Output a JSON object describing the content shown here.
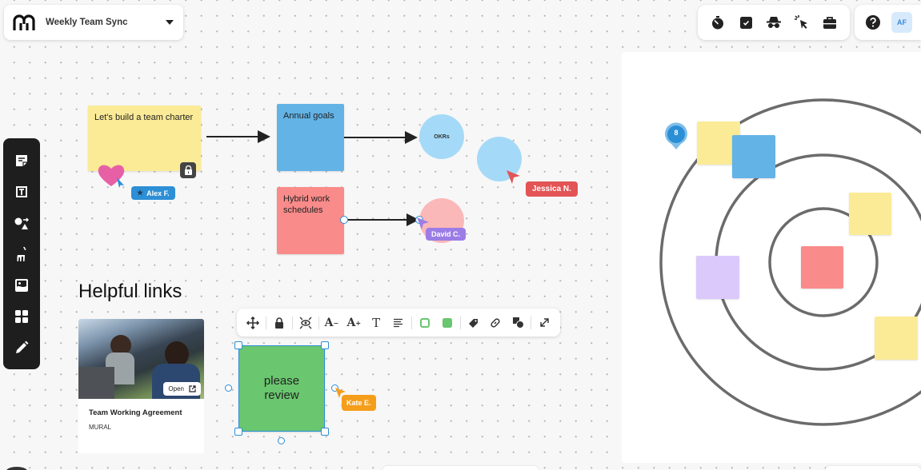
{
  "header": {
    "board_title": "Weekly Team Sync",
    "logo_icon": "mural-logo-icon",
    "dropdown_icon": "caret-down-icon"
  },
  "top_right_tools": [
    {
      "name": "timer",
      "icon": "stopwatch-icon"
    },
    {
      "name": "voting",
      "icon": "checkbox-icon"
    },
    {
      "name": "private-mode",
      "icon": "incognito-icon"
    },
    {
      "name": "summon",
      "icon": "cursor-click-icon"
    },
    {
      "name": "toolkit",
      "icon": "briefcase-icon"
    }
  ],
  "help": {
    "icon": "help-icon"
  },
  "user": {
    "initials": "AF"
  },
  "left_toolbar": [
    {
      "name": "sticky-note",
      "icon": "sticky-note-icon"
    },
    {
      "name": "text",
      "icon": "text-box-icon"
    },
    {
      "name": "shapes",
      "icon": "shapes-icon"
    },
    {
      "name": "templates",
      "icon": "llama-icon"
    },
    {
      "name": "images",
      "icon": "image-icon"
    },
    {
      "name": "frameworks",
      "icon": "grid-icon"
    },
    {
      "name": "draw",
      "icon": "pencil-icon"
    }
  ],
  "canvas": {
    "stickies": [
      {
        "id": "team-charter",
        "text": "Let's build a team charter",
        "color": "#fbeb96",
        "locked": true
      },
      {
        "id": "annual-goals",
        "text": "Annual goals",
        "color": "#63b3e6"
      },
      {
        "id": "hybrid-work",
        "text": "Hybrid work schedules",
        "color": "#f98b8a"
      },
      {
        "id": "please-review",
        "text": "please review",
        "color": "#6ac66f",
        "selected": true
      }
    ],
    "circles": [
      {
        "id": "okrs",
        "text": "OKRs",
        "color": "#a4daf7"
      },
      {
        "id": "blank-blue",
        "text": "",
        "color": "#a4daf7"
      },
      {
        "id": "blank-pink",
        "text": "",
        "color": "#fbb8b8"
      }
    ],
    "cursors": [
      {
        "name": "Alex F.",
        "color": "#2d8fd5",
        "starred": true
      },
      {
        "name": "Jessica N.",
        "color": "#e25455"
      },
      {
        "name": "David C.",
        "color": "#9c7ce6"
      },
      {
        "name": "Kate E.",
        "color": "#f59e1b"
      }
    ],
    "helpful_links": {
      "heading": "Helpful links",
      "card": {
        "title": "Team Working Agreement",
        "source": "MURAL",
        "open_label": "Open"
      }
    }
  },
  "context_toolbar": [
    {
      "name": "move",
      "icon": "move-icon"
    },
    {
      "name": "lock",
      "icon": "lock-icon"
    },
    {
      "name": "focus",
      "icon": "focus-eye-icon"
    },
    {
      "name": "decrease-font",
      "icon": "font-decrease-icon"
    },
    {
      "name": "increase-font",
      "icon": "font-increase-icon"
    },
    {
      "name": "text-style",
      "icon": "text-icon"
    },
    {
      "name": "align",
      "icon": "align-left-icon"
    },
    {
      "name": "border-color",
      "icon": "border-color-icon"
    },
    {
      "name": "fill-color",
      "icon": "fill-color-icon"
    },
    {
      "name": "tag",
      "icon": "tag-icon"
    },
    {
      "name": "link",
      "icon": "link-icon"
    },
    {
      "name": "shape",
      "icon": "shape-icon"
    },
    {
      "name": "expand",
      "icon": "expand-icon"
    }
  ],
  "target_panel": {
    "comment_count": "8",
    "rings": 3,
    "notes": [
      {
        "color": "#fbeb96",
        "ring": "outer"
      },
      {
        "color": "#63b3e6",
        "ring": "middle"
      },
      {
        "color": "#fbeb96",
        "ring": "inner-edge"
      },
      {
        "color": "#dcc9fc",
        "ring": "middle"
      },
      {
        "color": "#f98b8a",
        "ring": "center"
      },
      {
        "color": "#fbeb96",
        "ring": "middle-edge"
      }
    ]
  },
  "colors": {
    "accent": "#2b8fd6",
    "toolbar_dark": "#1e1e1e",
    "ring_stroke": "#6b6b6b"
  }
}
